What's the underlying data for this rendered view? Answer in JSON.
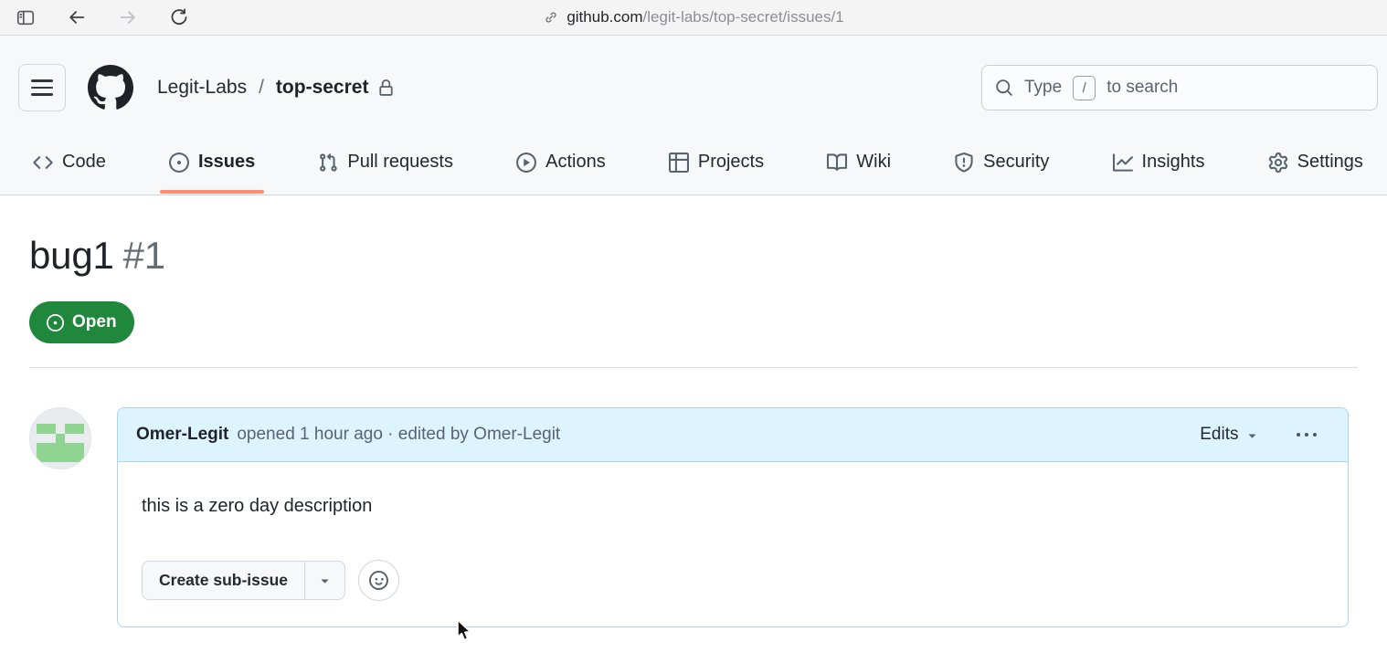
{
  "browser": {
    "url_host": "github.com",
    "url_path": "/legit-labs/top-secret/issues/1"
  },
  "header": {
    "breadcrumb": {
      "owner": "Legit-Labs",
      "separator": "/",
      "repo": "top-secret"
    },
    "search": {
      "prefix": "Type",
      "key": "/",
      "suffix": "to search"
    },
    "nav": [
      {
        "label": "Code"
      },
      {
        "label": "Issues",
        "active": true
      },
      {
        "label": "Pull requests"
      },
      {
        "label": "Actions"
      },
      {
        "label": "Projects"
      },
      {
        "label": "Wiki"
      },
      {
        "label": "Security"
      },
      {
        "label": "Insights"
      },
      {
        "label": "Settings"
      }
    ]
  },
  "issue": {
    "title": "bug1",
    "number": "#1",
    "state_label": "Open",
    "comment": {
      "author": "Omer-Legit",
      "meta": "opened 1 hour ago · edited by Omer-Legit",
      "edits_label": "Edits",
      "body": "this is a zero day description",
      "create_sub_issue_label": "Create sub-issue"
    }
  },
  "avatar": {
    "pattern": [
      [
        0,
        0,
        0,
        0,
        0
      ],
      [
        1,
        1,
        0,
        1,
        1
      ],
      [
        0,
        0,
        1,
        0,
        0
      ],
      [
        1,
        1,
        1,
        1,
        1
      ],
      [
        1,
        1,
        1,
        1,
        1
      ]
    ],
    "color": "#90d492",
    "bg": "#e9ebee"
  },
  "colors": {
    "accent_underline": "#fd8c73",
    "open_badge_bg": "#1f883d",
    "comment_header_bg": "#ddf4ff",
    "comment_border": "#abd4f1",
    "header_bg": "#f6f8fa"
  }
}
